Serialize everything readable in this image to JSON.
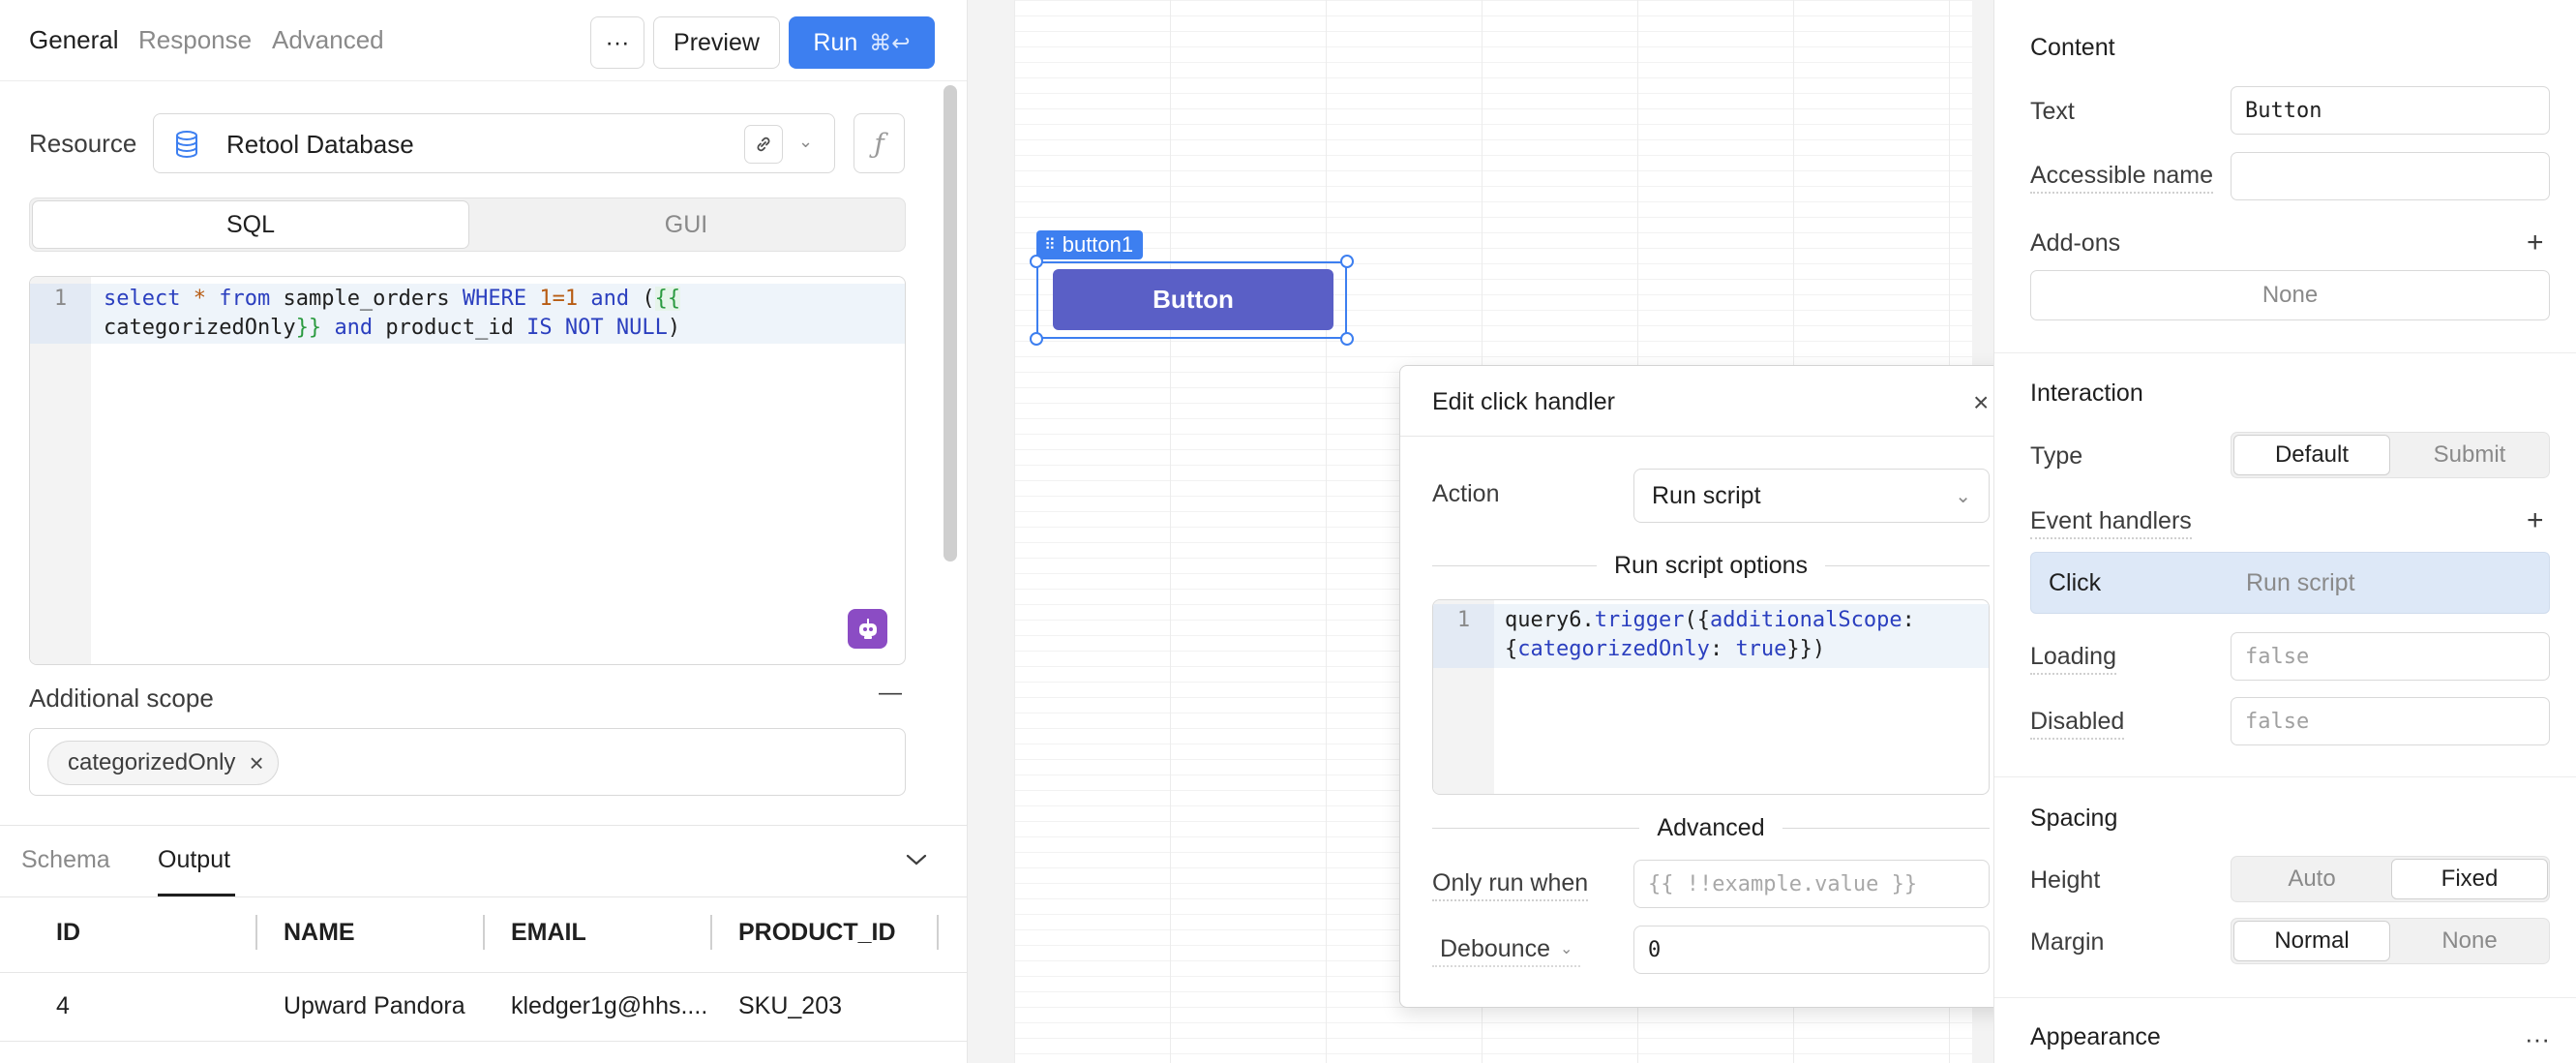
{
  "query_editor": {
    "tabs": [
      "General",
      "Response",
      "Advanced"
    ],
    "more_label": "···",
    "preview_label": "Preview",
    "run_label": "Run",
    "run_shortcut": "⌘↩",
    "resource_label": "Resource",
    "resource_value": "Retool Database",
    "fx_label": "ƒ",
    "mode_tabs": [
      "SQL",
      "GUI"
    ],
    "active_mode": "SQL",
    "sql_line_number": "1",
    "sql_line1_parts": [
      "select",
      " * ",
      "from",
      " sample_orders ",
      "WHERE",
      " ",
      "1",
      "=",
      "1",
      " ",
      "and",
      " (",
      "{{"
    ],
    "sql_line2_parts": [
      "categorizedOnly",
      "}}",
      " ",
      "and",
      " product_id ",
      "IS NOT NULL",
      ")"
    ],
    "additional_scope_label": "Additional scope",
    "additional_scope_collapse": "—",
    "scope_pill": "categorizedOnly",
    "scope_pill_remove": "×"
  },
  "output": {
    "tabs": [
      "Schema",
      "Output"
    ],
    "active_tab": "Output",
    "collapse_icon": "chevron-down-icon",
    "columns": [
      "ID",
      "NAME",
      "EMAIL",
      "PRODUCT_ID"
    ],
    "rows": [
      [
        "4",
        "Upward Pandora",
        "kledger1g@hhs....",
        "SKU_203"
      ]
    ]
  },
  "canvas": {
    "component_tag": "button1",
    "button_text": "Button"
  },
  "popover": {
    "title": "Edit click handler",
    "close": "×",
    "action_label": "Action",
    "action_value": "Run script",
    "script_section": "Run script options",
    "script_line_number": "1",
    "script_line1_parts": [
      "query6",
      ".",
      "trigger",
      "({",
      "additionalScope",
      ":"
    ],
    "script_line2_parts": [
      "{",
      "categorizedOnly",
      ": ",
      "true",
      "}})"
    ],
    "advanced_section": "Advanced",
    "only_run_when_label": "Only run when",
    "only_run_when_placeholder": "{{ !!example.value }}",
    "debounce_label": "Debounce",
    "debounce_value": "0"
  },
  "inspector": {
    "content_heading": "Content",
    "text_label": "Text",
    "text_value": "Button",
    "accessible_name_label": "Accessible name",
    "accessible_name_value": "",
    "addons_label": "Add-ons",
    "addons_value": "None",
    "interaction_heading": "Interaction",
    "type_label": "Type",
    "type_options": [
      "Default",
      "Submit"
    ],
    "type_active": "Default",
    "event_handlers_label": "Event handlers",
    "event_handler": {
      "event": "Click",
      "action": "Run script"
    },
    "loading_label": "Loading",
    "loading_placeholder": "false",
    "disabled_label": "Disabled",
    "disabled_placeholder": "false",
    "spacing_heading": "Spacing",
    "height_label": "Height",
    "height_options": [
      "Auto",
      "Fixed"
    ],
    "height_active": "Fixed",
    "margin_label": "Margin",
    "margin_options": [
      "Normal",
      "None"
    ],
    "margin_active": "Normal",
    "appearance_heading": "Appearance",
    "appearance_more": "···",
    "plus": "+"
  },
  "colors": {
    "accent": "#3d7ff0",
    "app_button": "#5a5fc6",
    "ai_button": "#8b4cc4",
    "event_row": "#dde8f7",
    "keyword": "#2b3fbf",
    "template": "#2a9a3f",
    "number": "#b75b12"
  }
}
